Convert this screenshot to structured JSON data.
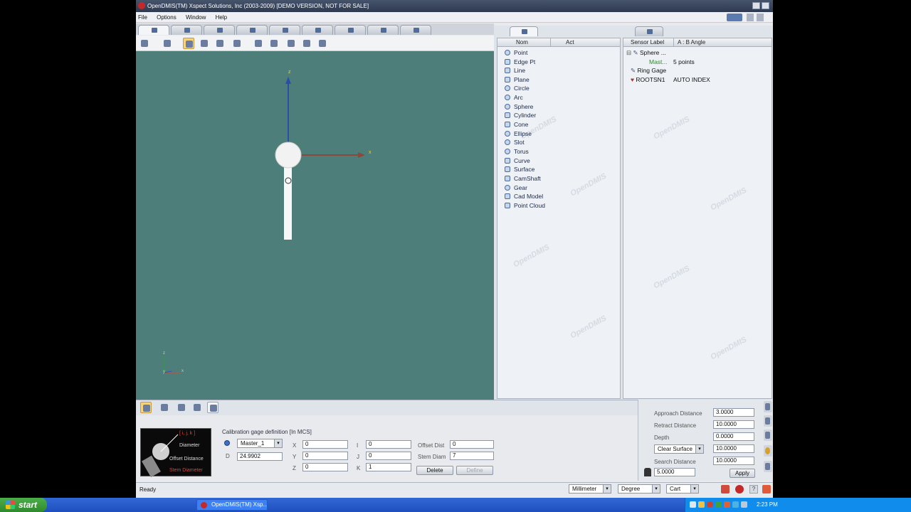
{
  "window": {
    "title": "OpenDMIS(TM) Xspect Solutions, Inc (2003-2009) [DEMO VERSION, NOT FOR SALE]"
  },
  "menu": [
    "File",
    "Options",
    "Window",
    "Help"
  ],
  "viewport": {
    "axis_z_label": "z",
    "axis_x_label": "x",
    "mini_axis_z": "z",
    "mini_axis_y": "y",
    "mini_axis_x": "x",
    "background_color": "#4d7e7a"
  },
  "features_pane": {
    "col_nom": "Nom",
    "col_act": "Act",
    "items": [
      "Point",
      "Edge Pt",
      "Line",
      "Plane",
      "Circle",
      "Arc",
      "Sphere",
      "Cylinder",
      "Cone",
      "Ellipse",
      "Slot",
      "Torus",
      "Curve",
      "Surface",
      "CamShaft",
      "Gear",
      "Cad Model",
      "Point Cloud"
    ],
    "watermark": "OpenDMIS"
  },
  "sensor_pane": {
    "col_label": "Sensor Label",
    "col_angle": "A : B Angle",
    "tree": [
      {
        "label": "Sphere ...",
        "value": ""
      },
      {
        "label": "Mast...",
        "value": "5 points"
      },
      {
        "label": "Ring Gage",
        "value": ""
      },
      {
        "label": "ROOTSN1",
        "value": "AUTO INDEX"
      }
    ]
  },
  "calibration": {
    "diagram_labels": {
      "ijk": "[ i, j, k ]",
      "diameter": "Diameter",
      "offset": "Offset Distance",
      "stem": "Stem Diameter"
    },
    "section_title": "Calibration gage definition [In MCS]",
    "gage_select": "Master_1",
    "d_label": "D",
    "d_value": "24.9902",
    "x_label": "X",
    "x_value": "0",
    "y_label": "Y",
    "y_value": "0",
    "z_label": "Z",
    "z_value": "0",
    "i_label": "I",
    "i_value": "0",
    "j_label": "J",
    "j_value": "0",
    "k_label": "K",
    "k_value": "1",
    "offset_label": "Offset Dist",
    "offset_value": "0",
    "stem_label": "Stem Diam",
    "stem_value": "7",
    "delete_button": "Delete",
    "define_button": "Define"
  },
  "settings": {
    "approach_label": "Approach Distance",
    "approach_value": "3.0000",
    "retract_label": "Retract Distance",
    "retract_value": "10.0000",
    "depth_label": "Depth",
    "depth_value": "0.0000",
    "clear_select": "Clear Surface",
    "clear_value": "10.0000",
    "search_label": "Search Distance",
    "search_value": "10.0000",
    "probe_value": "5.0000",
    "apply_button": "Apply"
  },
  "status": {
    "text": "Ready",
    "units": "Millimeter",
    "angle": "Degree",
    "coord": "Cart"
  },
  "taskbar": {
    "start_label": "start",
    "task_label": "OpenDMIS(TM) Xsp...",
    "clock": "2:23 PM"
  }
}
